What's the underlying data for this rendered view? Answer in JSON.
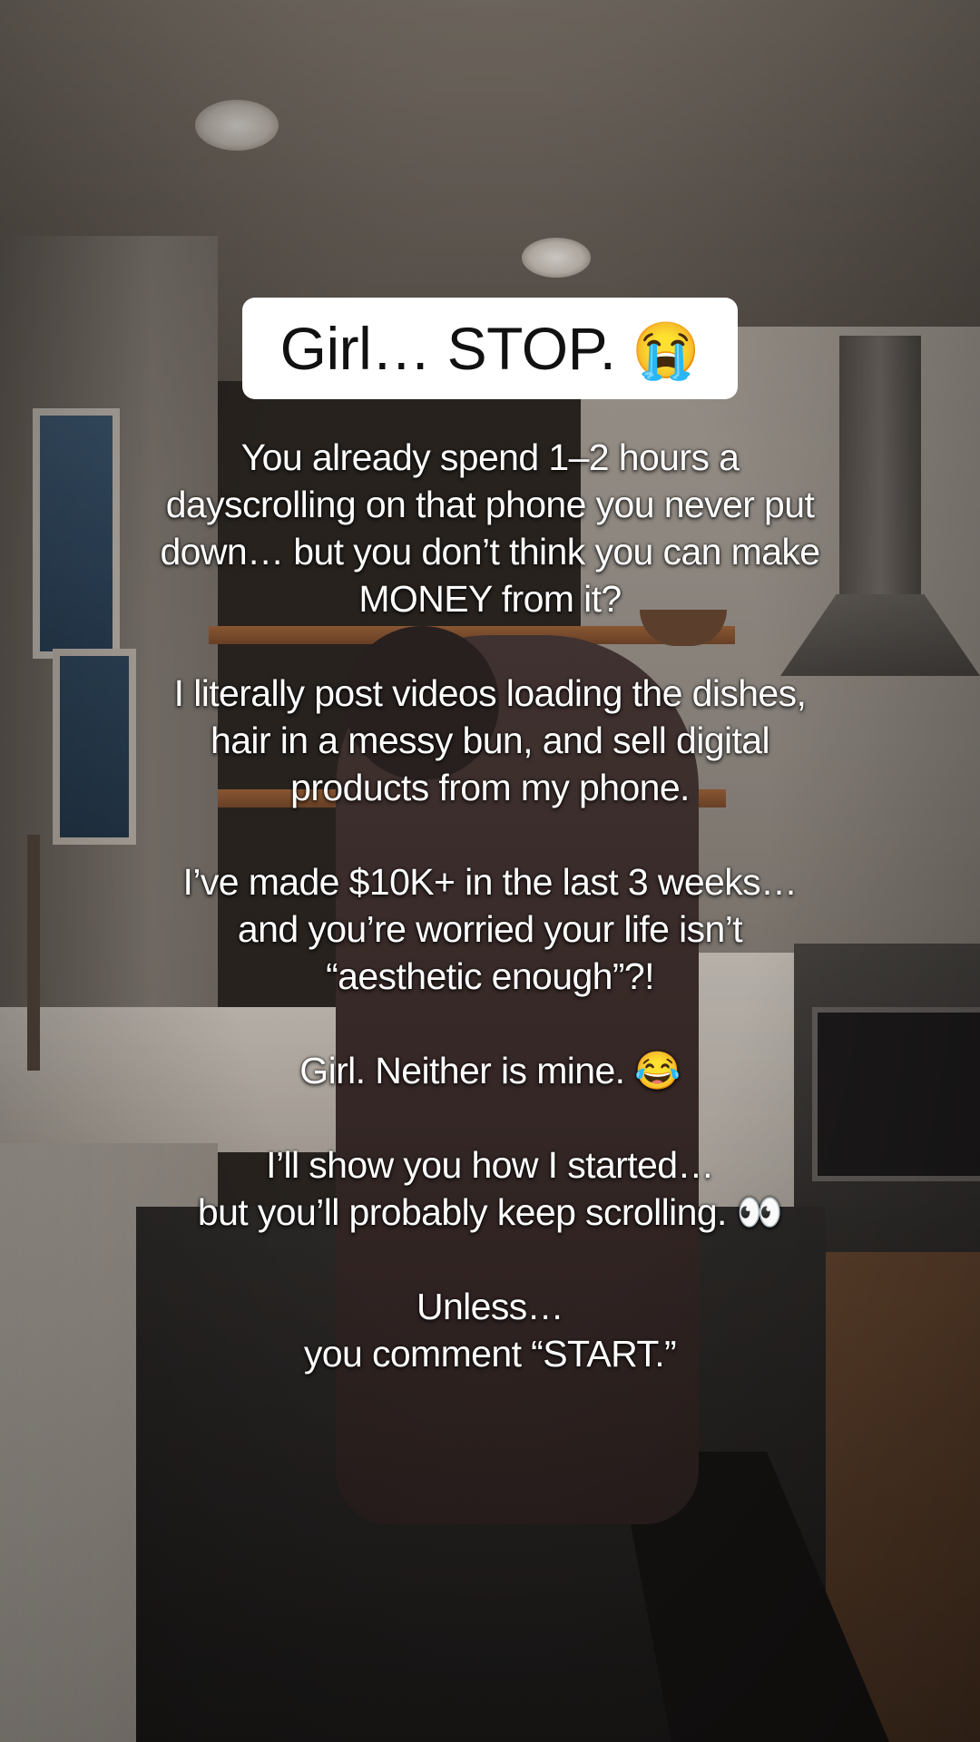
{
  "title": {
    "text": "Girl… STOP.",
    "emoji": "😭"
  },
  "caption": {
    "paragraphs": [
      {
        "lines": [
          "You already spend 1–2 hours a",
          "dayscrolling on that phone you never put",
          "down… but you don’t think you can make",
          "MONEY from it?"
        ]
      },
      {
        "lines": [
          "I literally post videos loading the dishes,",
          "hair in a messy bun, and sell digital",
          "products from my phone."
        ]
      },
      {
        "lines": [
          "I’ve made $10K+ in the last 3 weeks…",
          "and you’re worried your life isn’t",
          "“aesthetic enough”?!"
        ]
      },
      {
        "lines": [
          "Girl. Neither is mine. 😂"
        ]
      },
      {
        "lines": [
          "I’ll show you how I started…",
          "but you’ll probably keep scrolling. 👀"
        ]
      },
      {
        "lines": [
          "Unless…",
          "you comment “START.”"
        ]
      }
    ]
  },
  "colors": {
    "title_background": "#ffffff",
    "title_text": "#111111",
    "caption_text": "#ffffff"
  }
}
